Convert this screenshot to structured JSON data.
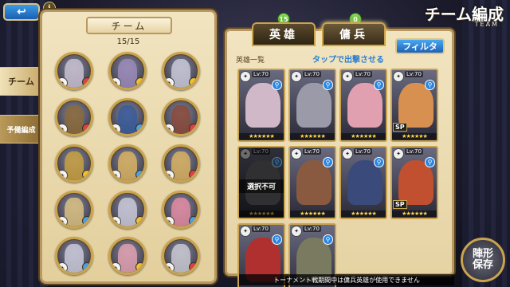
{
  "header": {
    "back_label": "↩",
    "info_label": "i",
    "title": "チーム編成",
    "subtitle": "TEAM"
  },
  "side_tabs": [
    {
      "label": "チーム"
    },
    {
      "label": "予備編成"
    }
  ],
  "team": {
    "title": "チーム",
    "count": "15/15",
    "members": [
      {
        "role": "✦",
        "elem": "#e04040",
        "color": "#c8c0d0"
      },
      {
        "role": "✦",
        "elem": "#f0c030",
        "color": "#9a8ab8"
      },
      {
        "role": "✦",
        "elem": "#f0c030",
        "color": "#c8c8d8"
      },
      {
        "role": "✦",
        "elem": "#e04040",
        "color": "#8a6a3a"
      },
      {
        "role": "✦",
        "elem": "#4aa0e0",
        "color": "#3a5a9a"
      },
      {
        "role": "✦",
        "elem": "#e04040",
        "color": "#8a4a3a"
      },
      {
        "role": "✦",
        "elem": "#f0c030",
        "color": "#c8a040"
      },
      {
        "role": "✦",
        "elem": "#4aa0e0",
        "color": "#d8b060"
      },
      {
        "role": "✦",
        "elem": "#e04040",
        "color": "#d8b060"
      },
      {
        "role": "✦",
        "elem": "#4aa0e0",
        "color": "#d8c080"
      },
      {
        "role": "✦",
        "elem": "#f0c030",
        "color": "#c8c8d8"
      },
      {
        "role": "✦",
        "elem": "#4aa0e0",
        "color": "#e08aa0"
      },
      {
        "role": "✦",
        "elem": "#4aa0e0",
        "color": "#c8c8d8"
      },
      {
        "role": "✦",
        "elem": "#f0c030",
        "color": "#e0a0b0"
      },
      {
        "role": "✦",
        "elem": "#e04040",
        "color": "#c8c8d0"
      }
    ]
  },
  "tabs": {
    "hero": {
      "label": "英雄",
      "count": "15"
    },
    "merc": {
      "label": "傭兵",
      "count": "0"
    }
  },
  "filter_label": "フィルタ",
  "list_label": "英雄一覧",
  "tap_hint": "タップで出撃させる",
  "heroes": [
    {
      "lv": "Lv:70",
      "stars": "★★★★★★",
      "sp": "",
      "disabled": false,
      "unavail": "",
      "color": "#d0b8c8"
    },
    {
      "lv": "Lv:70",
      "stars": "★★★★★★",
      "sp": "",
      "disabled": false,
      "unavail": "",
      "color": "#9a9aa8"
    },
    {
      "lv": "Lv:70",
      "stars": "★★★★★★",
      "sp": "",
      "disabled": false,
      "unavail": "",
      "color": "#e0a0b0"
    },
    {
      "lv": "Lv:70",
      "stars": "★★★★★★",
      "sp": "SP",
      "disabled": false,
      "unavail": "",
      "color": "#d89050"
    },
    {
      "lv": "Lv:70",
      "stars": "★★★★★★",
      "sp": "",
      "disabled": true,
      "unavail": "選択不可",
      "color": "#6a6a70"
    },
    {
      "lv": "Lv:70",
      "stars": "★★★★★★",
      "sp": "",
      "disabled": false,
      "unavail": "",
      "color": "#8a5a40"
    },
    {
      "lv": "Lv:70",
      "stars": "★★★★★★",
      "sp": "",
      "disabled": false,
      "unavail": "",
      "color": "#3a4a7a"
    },
    {
      "lv": "Lv:70",
      "stars": "★★★★★★",
      "sp": "SP",
      "disabled": false,
      "unavail": "",
      "color": "#c05030"
    },
    {
      "lv": "Lv:70",
      "stars": "",
      "sp": "",
      "disabled": false,
      "unavail": "",
      "color": "#b03030"
    },
    {
      "lv": "Lv:70",
      "stars": "",
      "sp": "",
      "disabled": false,
      "unavail": "",
      "color": "#7a7a60"
    }
  ],
  "notice": "トーナメント戦期間中は傭兵英雄が使用できません",
  "formation_button": {
    "line1": "陣形",
    "line2": "保存"
  }
}
